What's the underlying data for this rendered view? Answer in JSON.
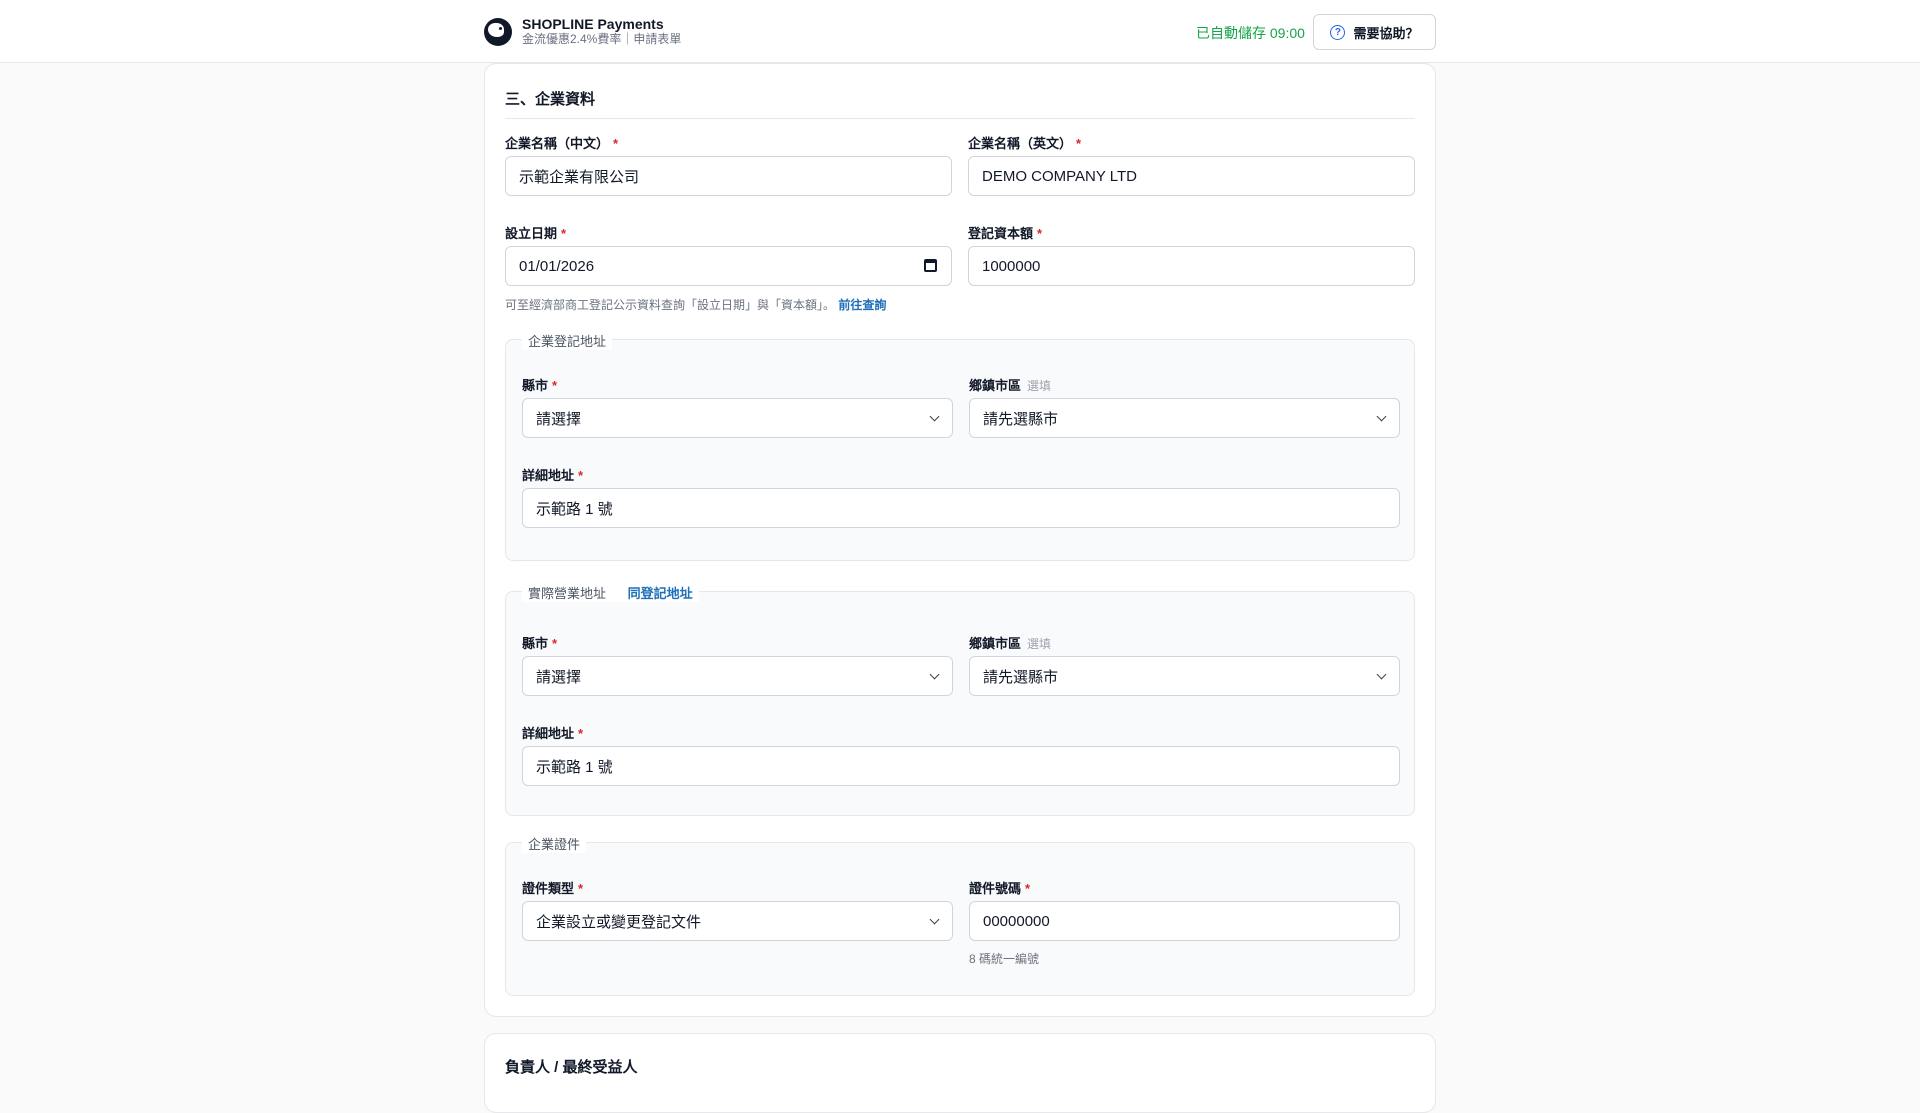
{
  "header": {
    "brand_name": "SHOPLINE Payments",
    "brand_subtitle": "金流優惠2.4%費率｜申請表單",
    "autosave_text": "已自動儲存 09:00",
    "help_label": "需要協助？",
    "autosave_color": "#16a34a"
  },
  "section": {
    "title": "三、企業資料",
    "company_name_zh": {
      "label": "企業名稱（中文）",
      "value": "示範企業有限公司"
    },
    "company_name_en": {
      "label": "企業名稱（英文）",
      "value": "DEMO COMPANY LTD"
    },
    "established_date": {
      "label": "設立日期",
      "value": "01/01/2026"
    },
    "registered_capital": {
      "label": "登記資本額",
      "value": "1000000"
    },
    "hint_text": "可至經濟部商工登記公示資料查詢「設立日期」與「資本額」。",
    "hint_link": "前往查詢",
    "registered_address": {
      "legend": "企業登記地址",
      "city_label": "縣市",
      "city_value": "請選擇",
      "district_label": "鄉鎮市區",
      "district_optional": "選填",
      "district_value": "請先選縣市",
      "detail_label": "詳細地址",
      "detail_value": "示範路 1 號"
    },
    "business_address": {
      "legend": "實際營業地址",
      "same_link": "同登記地址",
      "city_label": "縣市",
      "city_value": "請選擇",
      "district_label": "鄉鎮市區",
      "district_optional": "選填",
      "district_value": "請先選縣市",
      "detail_label": "詳細地址",
      "detail_value": "示範路 1 號"
    },
    "certificate": {
      "legend": "企業證件",
      "type_label": "證件類型",
      "type_value": "企業設立或變更登記文件",
      "number_label": "證件號碼",
      "number_value": "00000000",
      "number_hint": "8 碼統一編號"
    },
    "required_mark": "*"
  },
  "next_section": {
    "title": "負責人 / 最終受益人"
  }
}
